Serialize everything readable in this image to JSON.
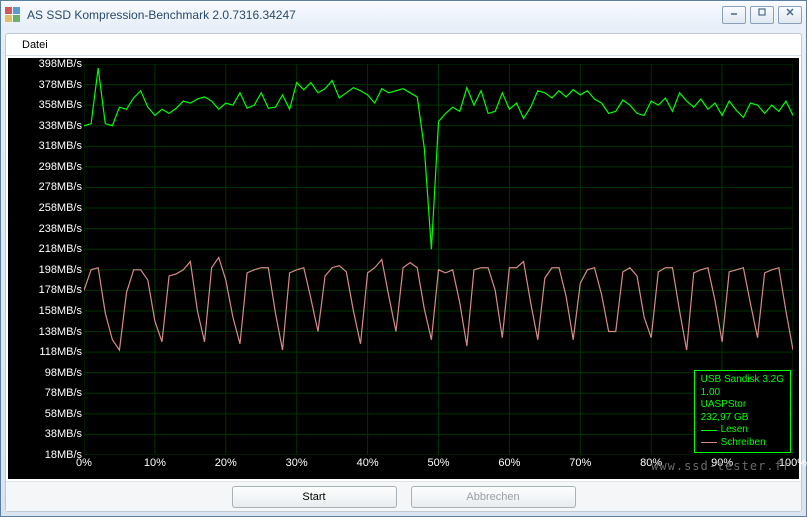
{
  "window": {
    "title": "AS SSD Kompression-Benchmark 2.0.7316.34247"
  },
  "menu": {
    "datei": "Datei"
  },
  "buttons": {
    "start": "Start",
    "abort": "Abbrechen"
  },
  "legend": {
    "device": "USB  Sandisk 3.2G",
    "fw": "1.00",
    "driver": "UASPStor",
    "size": "232,97 GB",
    "read": "Lesen",
    "write": "Schreiben",
    "read_color": "#00ff00",
    "write_color": "#d88a8a"
  },
  "watermark": "www.ssd-tester.fr",
  "chart_data": {
    "type": "line",
    "title": "",
    "xlabel": "",
    "ylabel": "MB/s",
    "ylim": [
      18,
      398
    ],
    "xlim": [
      0,
      100
    ],
    "y_ticks": [
      398,
      378,
      358,
      338,
      318,
      298,
      278,
      258,
      238,
      218,
      198,
      178,
      158,
      138,
      118,
      98,
      78,
      58,
      38,
      18
    ],
    "y_tick_labels": [
      "398MB/s",
      "378MB/s",
      "358MB/s",
      "338MB/s",
      "318MB/s",
      "298MB/s",
      "278MB/s",
      "258MB/s",
      "238MB/s",
      "218MB/s",
      "198MB/s",
      "178MB/s",
      "158MB/s",
      "138MB/s",
      "118MB/s",
      "98MB/s",
      "78MB/s",
      "58MB/s",
      "38MB/s",
      "18MB/s"
    ],
    "x_ticks": [
      0,
      10,
      20,
      30,
      40,
      50,
      60,
      70,
      80,
      90,
      100
    ],
    "x_tick_labels": [
      "0%",
      "10%",
      "20%",
      "30%",
      "40%",
      "50%",
      "60%",
      "70%",
      "80%",
      "90%",
      "100%"
    ],
    "series": [
      {
        "name": "Lesen",
        "color": "#00ff00",
        "x": [
          0,
          1,
          2,
          3,
          4,
          5,
          6,
          7,
          8,
          9,
          10,
          11,
          12,
          13,
          14,
          15,
          16,
          17,
          18,
          19,
          20,
          21,
          22,
          23,
          24,
          25,
          26,
          27,
          28,
          29,
          30,
          31,
          32,
          33,
          34,
          35,
          36,
          37,
          38,
          39,
          40,
          41,
          42,
          43,
          44,
          45,
          46,
          47,
          48,
          49,
          50,
          51,
          52,
          53,
          54,
          55,
          56,
          57,
          58,
          59,
          60,
          61,
          62,
          63,
          64,
          65,
          66,
          67,
          68,
          69,
          70,
          71,
          72,
          73,
          74,
          75,
          76,
          77,
          78,
          79,
          80,
          81,
          82,
          83,
          84,
          85,
          86,
          87,
          88,
          89,
          90,
          91,
          92,
          93,
          94,
          95,
          96,
          97,
          98,
          99,
          100
        ],
        "y": [
          338,
          340,
          394,
          340,
          338,
          356,
          354,
          365,
          372,
          356,
          348,
          354,
          350,
          355,
          362,
          360,
          364,
          366,
          362,
          354,
          360,
          358,
          370,
          355,
          358,
          370,
          355,
          356,
          368,
          354,
          380,
          373,
          380,
          370,
          374,
          382,
          365,
          370,
          375,
          372,
          368,
          360,
          374,
          370,
          372,
          374,
          370,
          366,
          316,
          218,
          342,
          350,
          356,
          352,
          375,
          358,
          372,
          350,
          352,
          370,
          354,
          360,
          345,
          356,
          372,
          370,
          365,
          372,
          366,
          373,
          368,
          372,
          364,
          360,
          350,
          352,
          363,
          358,
          350,
          348,
          362,
          358,
          365,
          352,
          370,
          362,
          356,
          364,
          354,
          360,
          348,
          362,
          353,
          346,
          360,
          358,
          350,
          358,
          352,
          362,
          348
        ]
      },
      {
        "name": "Schreiben",
        "color": "#d88a8a",
        "x": [
          0,
          1,
          2,
          3,
          4,
          5,
          6,
          7,
          8,
          9,
          10,
          11,
          12,
          13,
          14,
          15,
          16,
          17,
          18,
          19,
          20,
          21,
          22,
          23,
          24,
          25,
          26,
          27,
          28,
          29,
          30,
          31,
          32,
          33,
          34,
          35,
          36,
          37,
          38,
          39,
          40,
          41,
          42,
          43,
          44,
          45,
          46,
          47,
          48,
          49,
          50,
          51,
          52,
          53,
          54,
          55,
          56,
          57,
          58,
          59,
          60,
          61,
          62,
          63,
          64,
          65,
          66,
          67,
          68,
          69,
          70,
          71,
          72,
          73,
          74,
          75,
          76,
          77,
          78,
          79,
          80,
          81,
          82,
          83,
          84,
          85,
          86,
          87,
          88,
          89,
          90,
          91,
          92,
          93,
          94,
          95,
          96,
          97,
          98,
          99,
          100
        ],
        "y": [
          178,
          198,
          200,
          156,
          130,
          120,
          176,
          198,
          198,
          188,
          148,
          128,
          192,
          194,
          198,
          206,
          158,
          128,
          200,
          210,
          188,
          152,
          126,
          195,
          198,
          200,
          200,
          156,
          120,
          195,
          198,
          200,
          170,
          138,
          192,
          200,
          202,
          196,
          158,
          126,
          195,
          200,
          208,
          172,
          138,
          200,
          205,
          200,
          160,
          130,
          198,
          195,
          198,
          166,
          124,
          198,
          200,
          200,
          178,
          132,
          200,
          200,
          206,
          166,
          130,
          190,
          200,
          200,
          172,
          130,
          185,
          198,
          200,
          174,
          138,
          138,
          196,
          200,
          192,
          152,
          132,
          196,
          200,
          200,
          158,
          120,
          195,
          198,
          200,
          168,
          128,
          196,
          198,
          200,
          165,
          132,
          195,
          198,
          200,
          158,
          120
        ]
      }
    ]
  }
}
